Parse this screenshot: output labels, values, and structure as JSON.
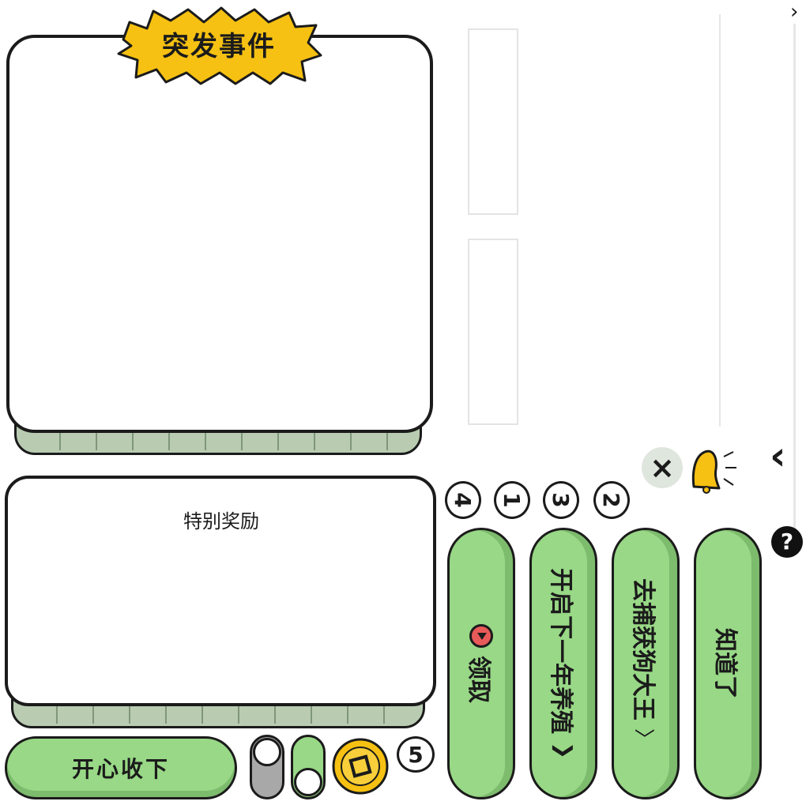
{
  "event_panel": {
    "title": "突发事件"
  },
  "reward_panel": {
    "title": "特别奖励"
  },
  "buttons": {
    "happy_accept": "开心收下",
    "claim": "领取",
    "next_year": "开启下一年养殖",
    "catch_king": "去捕获狗大王",
    "got_it": "知道了"
  },
  "numbers": {
    "n1": "1",
    "n2": "2",
    "n3": "3",
    "n4": "4",
    "n5": "5"
  },
  "icons": {
    "close": "×",
    "help": "?",
    "back": "‹",
    "forward": "›",
    "next_year_arrow": "❯",
    "catch_king_arrow": "〉"
  },
  "toggles": {
    "toggle_off": false,
    "toggle_on": true
  },
  "colors": {
    "button_green": "#98d886",
    "burst_yellow": "#f6c112",
    "outline": "#1b1b1b",
    "panel_shadow": "#b9ccb2",
    "record_red": "#e85a5a"
  }
}
